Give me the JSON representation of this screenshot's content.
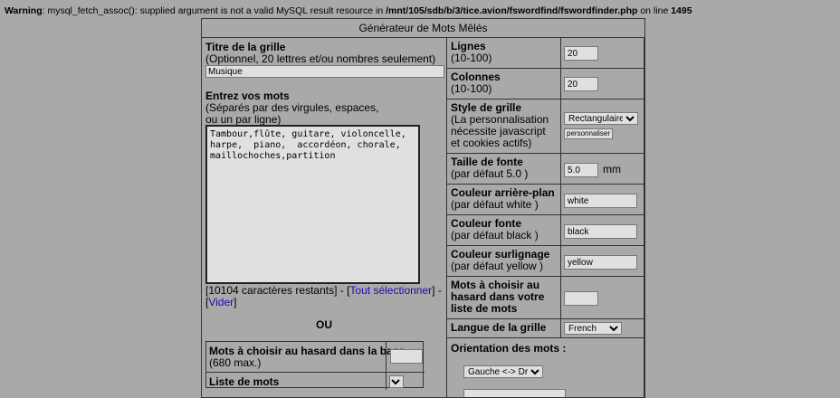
{
  "warning": {
    "prefix": "Warning",
    "message": ": mysql_fetch_assoc(): supplied argument is not a valid MySQL result resource in ",
    "path": "/mnt/105/sdb/b/3/tice.avion/fswordfind/fswordfinder.php",
    "line_text": " on line ",
    "line_number": "1495"
  },
  "panel": {
    "title": "Générateur de Mots Mêlés"
  },
  "left": {
    "grid_title_label": "Titre de la grille",
    "grid_title_hint": "(Optionnel, 20 lettres et/ou nombres seulement)",
    "grid_title_value": "Musique",
    "words_label": "Entrez vos mots",
    "words_hint_1": "(Séparés par des virgules, espaces,",
    "words_hint_2": "ou un par ligne)",
    "words_value": "Tambour,flûte, guitare, violoncelle,\nharpe,  piano,  accordéon, chorale,\nmaillochoches,partition",
    "remaining_text": "[10104 caractères restants] - [",
    "select_all": "Tout sélectionner",
    "sep": "] -",
    "clear_open": "[",
    "clear": "Vider",
    "clear_close": "]",
    "or": "OU",
    "random_db_label": "Mots à choisir au hasard dans la base",
    "random_db_hint": "(680 max.)",
    "random_db_value": "",
    "word_list_label": "Liste de mots"
  },
  "right": {
    "rows_label": "Lignes",
    "rows_hint": "(10-100)",
    "rows_value": "20",
    "cols_label": "Colonnes",
    "cols_hint": "(10-100)",
    "cols_value": "20",
    "style_label": "Style de grille",
    "style_hint": "(La personnalisation nécessite javascript et cookies actifs)",
    "style_value": "Rectangulaire",
    "customize": "personnaliser",
    "font_size_label": "Taille de fonte",
    "font_size_hint": "(par défaut 5.0 )",
    "font_size_value": "5.0",
    "font_size_unit": "mm",
    "bg_color_label": "Couleur arrière-plan",
    "bg_color_hint": "(par défaut white )",
    "bg_color_value": "white",
    "font_color_label": "Couleur fonte",
    "font_color_hint": "(par défaut black )",
    "font_color_value": "black",
    "highlight_label": "Couleur surlignage",
    "highlight_hint": "(par défaut yellow )",
    "highlight_value": "yellow",
    "random_list_label": "Mots à choisir au hasard dans votre liste de mots",
    "random_list_value": "",
    "language_label": "Langue de la grille",
    "language_value": "French",
    "orientation_label": "Orientation des mots :",
    "orientation_value": "Gauche <-> Droite"
  },
  "colors": {
    "background": "#a9a9a9",
    "field": "#e0e0e0",
    "link": "#1a0dab"
  }
}
